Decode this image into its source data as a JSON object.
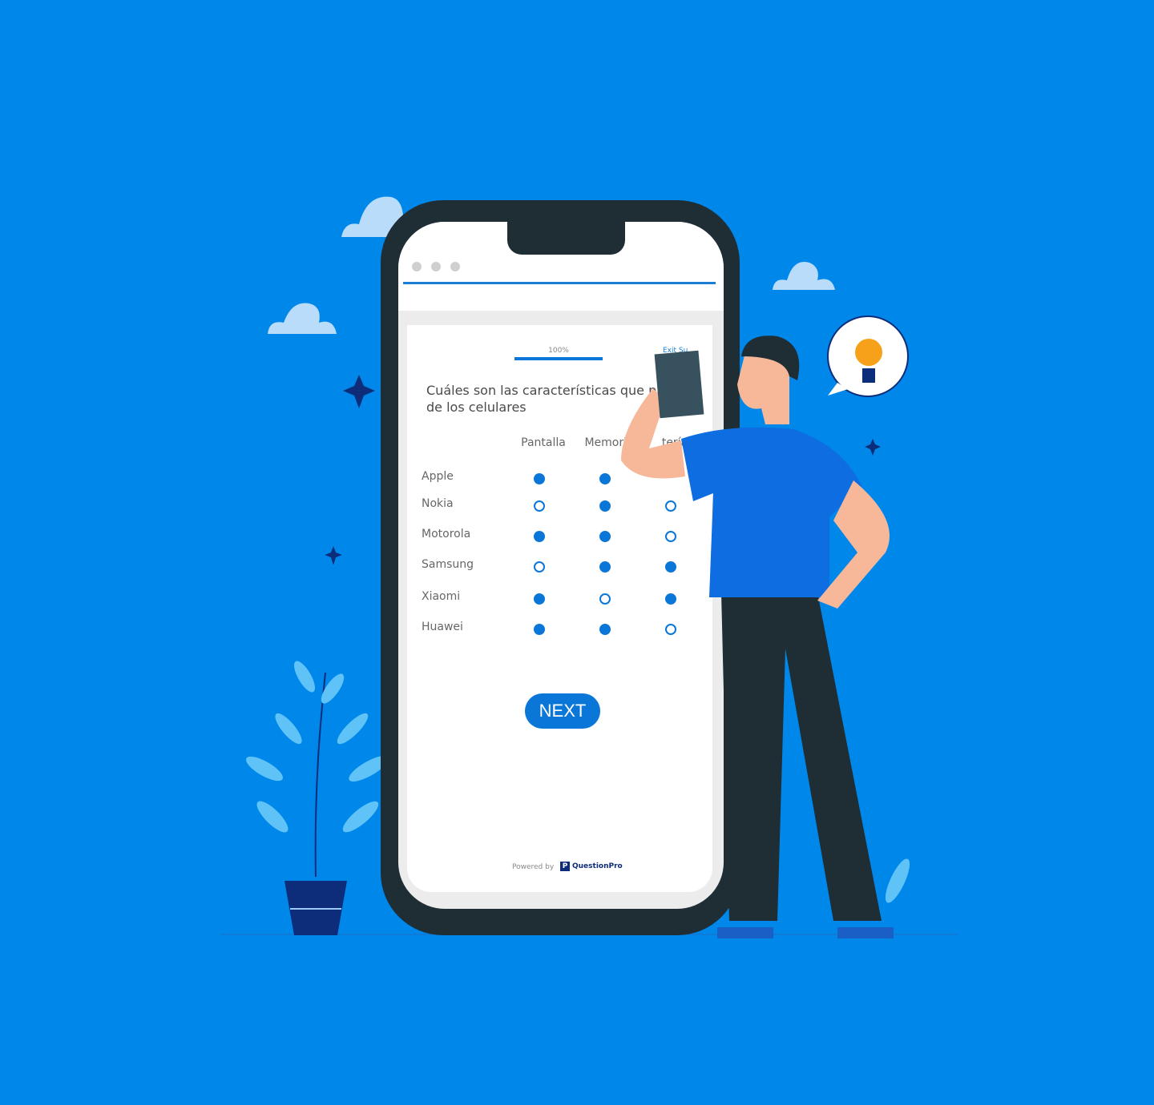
{
  "colors": {
    "background": "#0087EA",
    "accent": "#0a77d8",
    "phone": "#1f2d35"
  },
  "survey": {
    "progress_label": "100%",
    "progress": 100,
    "exit_label": "Exit Su",
    "question_line1": "Cuáles son las características que pr",
    "question_line2": "de los celulares",
    "columns": [
      "Pantalla",
      "Memoria",
      "tería"
    ],
    "rows": [
      {
        "label": "Apple",
        "values": [
          true,
          true,
          null
        ]
      },
      {
        "label": "Nokia",
        "values": [
          false,
          true,
          false
        ]
      },
      {
        "label": "Motorola",
        "values": [
          true,
          true,
          false
        ]
      },
      {
        "label": "Samsung",
        "values": [
          false,
          true,
          true
        ]
      },
      {
        "label": "Xiaomi",
        "values": [
          true,
          false,
          true
        ]
      },
      {
        "label": "Huawei",
        "values": [
          true,
          true,
          false
        ]
      }
    ],
    "next_label": "NEXT",
    "powered_by": "Powered by",
    "brand": "QuestionPro"
  },
  "icons": [
    "cloud-icon",
    "sparkle-icon",
    "lightbulb-icon",
    "plant-illustration",
    "person-illustration"
  ]
}
